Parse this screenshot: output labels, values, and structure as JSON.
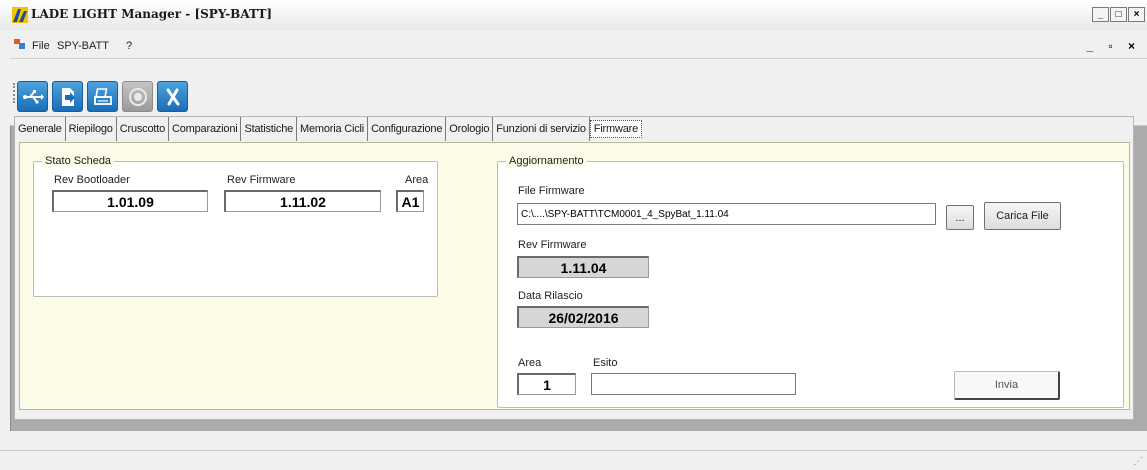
{
  "window": {
    "title": "LADE LIGHT Manager - [SPY-BATT]",
    "controls": [
      "_",
      "□",
      "×"
    ]
  },
  "menu": {
    "items": [
      "File",
      "SPY-BATT",
      "?"
    ],
    "mdi_controls": "_ ▫ ×"
  },
  "toolbar": {
    "buttons": [
      {
        "icon": "usb-icon",
        "enabled": true
      },
      {
        "icon": "export-icon",
        "enabled": true
      },
      {
        "icon": "print-icon",
        "enabled": true
      },
      {
        "icon": "record-icon",
        "enabled": false
      },
      {
        "icon": "close-x-icon",
        "enabled": true
      }
    ]
  },
  "tabs": [
    "Generale",
    "Riepilogo",
    "Cruscotto",
    "Comparazioni",
    "Statistiche",
    "Memoria Cicli",
    "Configurazione",
    "Orologio",
    "Funzioni di servizio",
    "Firmware"
  ],
  "active_tab": "Firmware",
  "stato_scheda": {
    "title": "Stato Scheda",
    "bootloader_label": "Rev Bootloader",
    "bootloader_value": "1.01.09",
    "firmware_label": "Rev Firmware",
    "firmware_value": "1.11.02",
    "area_label": "Area",
    "area_value": "A1"
  },
  "aggiornamento": {
    "title": "Aggiornamento",
    "file_label": "File Firmware",
    "file_path": "C:\\....\\SPY-BATT\\TCM0001_4_SpyBat_1.11.04",
    "browse_label": "...",
    "load_label": "Carica File",
    "rev_label": "Rev Firmware",
    "rev_value": "1.11.04",
    "date_label": "Data Rilascio",
    "date_value": "26/02/2016",
    "area_label": "Area",
    "area_value": "1",
    "esito_label": "Esito",
    "esito_value": "",
    "send_label": "Invia"
  },
  "colors": {
    "panel_bg": "#fbfbe7",
    "toolbar_button": "#2a80c8"
  }
}
